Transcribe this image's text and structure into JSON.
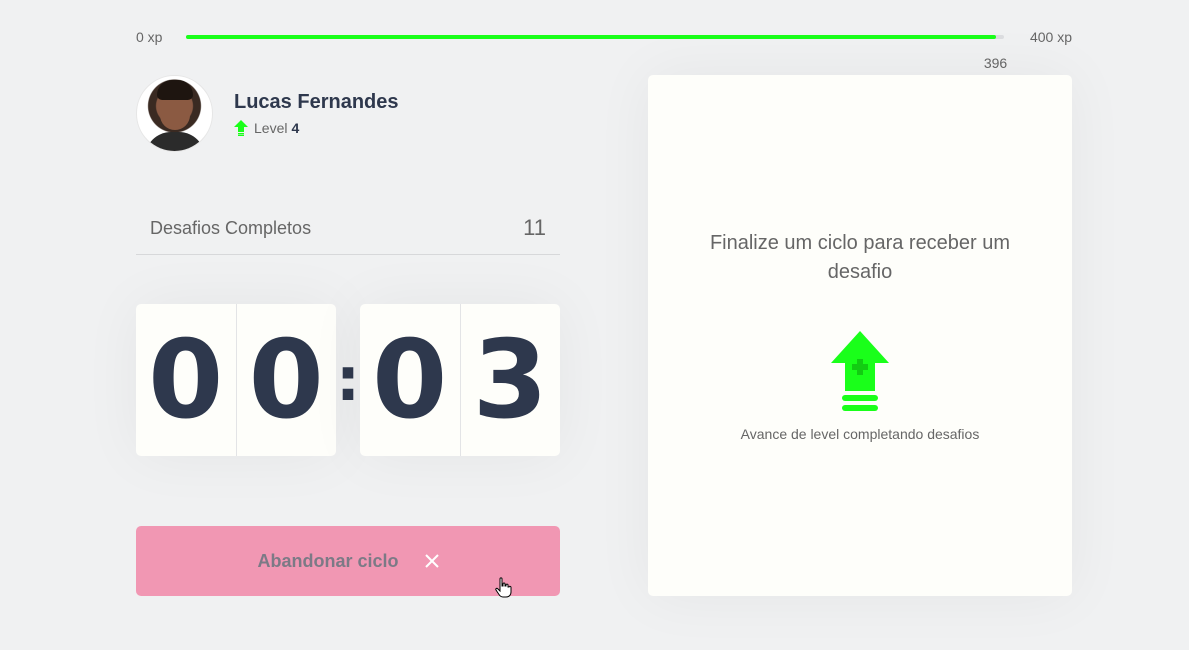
{
  "xp": {
    "min_label": "0 xp",
    "max_label": "400 xp",
    "current_label": "396 xp",
    "current": 396,
    "max": 400
  },
  "profile": {
    "name": "Lucas Fernandes",
    "level_label": "Level",
    "level": "4"
  },
  "stats": {
    "completed_label": "Desafios Completos",
    "completed_count": "11"
  },
  "countdown": {
    "minutes": [
      "0",
      "0"
    ],
    "seconds": [
      "0",
      "3"
    ],
    "separator": ":"
  },
  "abandon_button": {
    "label": "Abandonar ciclo"
  },
  "challenge": {
    "title": "Finalize um ciclo para receber um desafio",
    "hint": "Avance de level completando desafios"
  },
  "colors": {
    "accent_green": "#1aff1a",
    "title_dark": "#2e384d",
    "abandon_pink": "#f197b3",
    "background": "#f0f1f2"
  },
  "icons": {
    "level": "level-up-arrow-icon",
    "close": "close-icon",
    "cursor": "hand-pointer-icon"
  }
}
